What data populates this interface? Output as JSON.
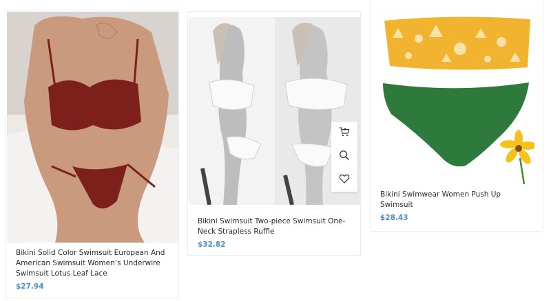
{
  "products": [
    {
      "title": "Bikini Solid Color Swimsuit European And American Swimsuit Women’s Underwire Swimsuit Lotus Leaf Lace",
      "price": "$27.94",
      "image": "red-bikini-photo"
    },
    {
      "title": "Bikini Swimsuit Two-piece Swimsuit One-Neck Strapless Ruffle",
      "price": "$32.82",
      "image": "white-ruffle-bikini-photo"
    },
    {
      "title": "Bikini Swimwear Women Push Up Swimsuit",
      "price": "$28.43",
      "image": "yellow-green-bikini-photo"
    }
  ],
  "hover_actions": [
    {
      "icon": "cart-icon"
    },
    {
      "icon": "search-icon"
    },
    {
      "icon": "heart-icon"
    }
  ],
  "colors": {
    "price": "#4a90c8",
    "title": "#2b2b2b",
    "border": "#ececec"
  }
}
